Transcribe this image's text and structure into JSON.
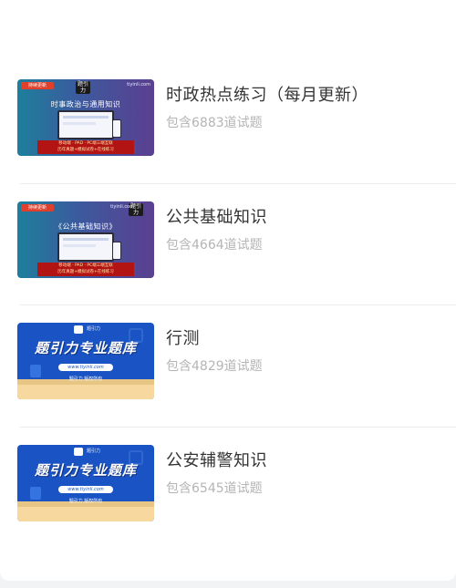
{
  "items": [
    {
      "title": "时政热点练习（每月更新）",
      "count": "包含6883道试题",
      "thumb": {
        "style": "purple",
        "tag": "持续更新",
        "site": "tiyinli.com",
        "logo": "题引力",
        "headline": "时事政治与通用知识",
        "banner_line1": "移动端 · PAD · PC端三端互联",
        "banner_line2": "历年真题+模拟试卷+在线练习"
      }
    },
    {
      "title": "公共基础知识",
      "count": "包含4664道试题",
      "thumb": {
        "style": "purple",
        "tag": "持续更新",
        "site": "tiyinli.com",
        "logo": "题引力",
        "headline": "《公共基础知识》",
        "banner_line1": "移动端 · PAD · PC端三端互联",
        "banner_line2": "历年真题+模拟试卷+在线练习"
      }
    },
    {
      "title": "行测",
      "count": "包含4829道试题",
      "thumb": {
        "style": "blue",
        "logo": "题引力",
        "headline": "题引力专业题库",
        "url": "www.tiyinli.com",
        "copy": "题引力 版权所有"
      }
    },
    {
      "title": "公安辅警知识",
      "count": "包含6545道试题",
      "thumb": {
        "style": "blue",
        "logo": "题引力",
        "headline": "题引力专业题库",
        "url": "www.tiyinli.com",
        "copy": "题引力 版权所有"
      }
    }
  ]
}
